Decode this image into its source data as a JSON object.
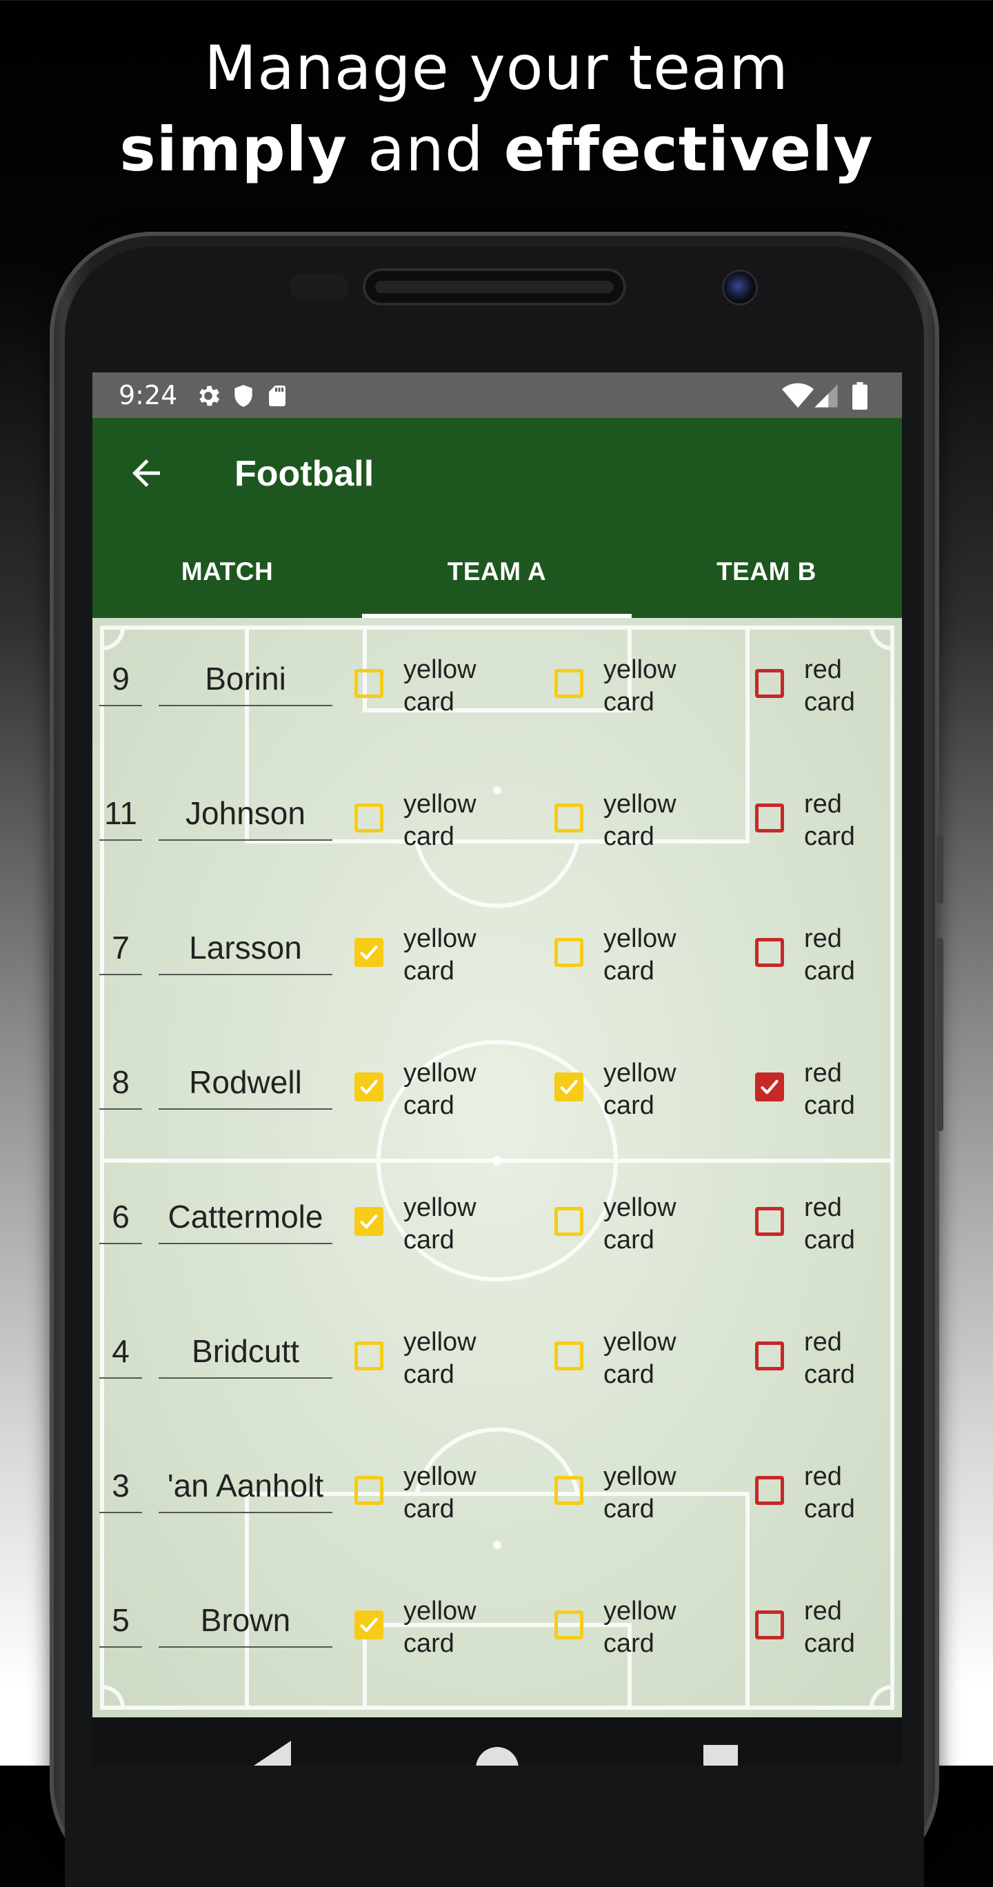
{
  "promo": {
    "line1": "Manage your team",
    "line2_bold1": "simply",
    "line2_mid": " and ",
    "line2_bold2": "effectively"
  },
  "status_bar": {
    "time": "9:24",
    "icons": [
      "gear-icon",
      "shield-icon",
      "sd-card-icon",
      "wifi-icon",
      "signal-icon",
      "battery-icon"
    ]
  },
  "app_bar": {
    "back_icon": "arrow-left-icon",
    "title": "Football"
  },
  "tabs": [
    {
      "label": "MATCH",
      "active": false
    },
    {
      "label": "TEAM A",
      "active": true
    },
    {
      "label": "TEAM B",
      "active": false
    }
  ],
  "card_labels": {
    "yellow_line1": "yellow",
    "yellow_line2": "card",
    "red_line1": "red",
    "red_line2": "card"
  },
  "colors": {
    "app_bar": "#1e5620",
    "status_bar": "#616161",
    "yellow_card": "#f6cc17",
    "red_card": "#c62828"
  },
  "players": [
    {
      "number": "9",
      "name": "Borini",
      "yellow1": false,
      "yellow2": false,
      "red": false
    },
    {
      "number": "11",
      "name": "Johnson",
      "yellow1": false,
      "yellow2": false,
      "red": false
    },
    {
      "number": "7",
      "name": "Larsson",
      "yellow1": true,
      "yellow2": false,
      "red": false
    },
    {
      "number": "8",
      "name": "Rodwell",
      "yellow1": true,
      "yellow2": true,
      "red": true
    },
    {
      "number": "6",
      "name": "Cattermole",
      "yellow1": true,
      "yellow2": false,
      "red": false
    },
    {
      "number": "4",
      "name": "Bridcutt",
      "yellow1": false,
      "yellow2": false,
      "red": false
    },
    {
      "number": "3",
      "name": "'an Aanholt",
      "yellow1": false,
      "yellow2": false,
      "red": false
    },
    {
      "number": "5",
      "name": "Brown",
      "yellow1": true,
      "yellow2": false,
      "red": false
    }
  ],
  "nav_bar": {
    "icons": [
      "back-triangle-icon",
      "home-circle-icon",
      "recents-square-icon"
    ]
  }
}
